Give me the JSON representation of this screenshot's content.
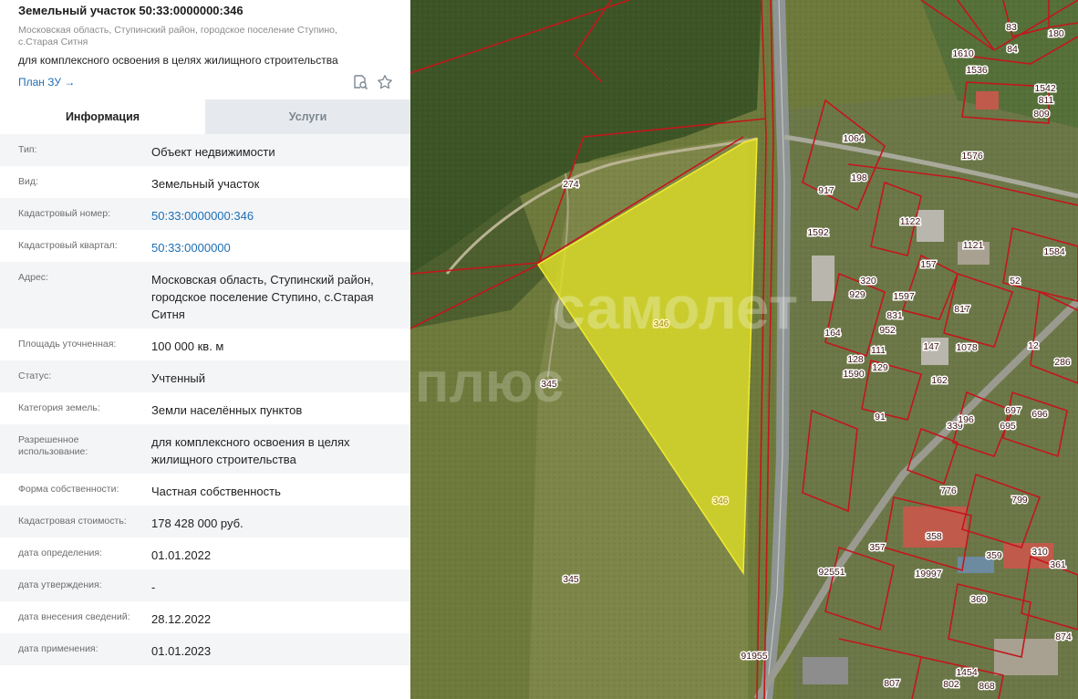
{
  "header": {
    "title": "Земельный участок 50:33:0000000:346",
    "address_line1": "Московская область, Ступинский район, городское поселение Ступино,",
    "address_line2": "с.Старая Ситня",
    "purpose": "для комплексного освоения в целях жилищного строительства",
    "plan_link": "План ЗУ →",
    "icons": {
      "doc": "document-search-icon",
      "star": "star-icon"
    }
  },
  "tabs": [
    {
      "label": "Информация",
      "active": true
    },
    {
      "label": "Услуги",
      "active": false
    }
  ],
  "rows": [
    {
      "label": "Тип:",
      "value": "Объект недвижимости"
    },
    {
      "label": "Вид:",
      "value": "Земельный участок"
    },
    {
      "label": "Кадастровый номер:",
      "value": "50:33:0000000:346",
      "link": true
    },
    {
      "label": "Кадастровый квартал:",
      "value": "50:33:0000000",
      "link": true
    },
    {
      "label": "Адрес:",
      "value": "Московская область, Ступинский район, городское поселение Ступино, с.Старая Ситня"
    },
    {
      "label": "Площадь уточненная:",
      "value": "100 000 кв. м"
    },
    {
      "label": "Статус:",
      "value": "Учтенный"
    },
    {
      "label": "Категория земель:",
      "value": "Земли населённых пунктов"
    },
    {
      "label": "Разрешенное использование:",
      "value": "для комплексного освоения в целях жилищного строительства"
    },
    {
      "label": "Форма собственности:",
      "value": "Частная собственность"
    },
    {
      "label": "Кадастровая стоимость:",
      "value": "178 428 000 руб."
    },
    {
      "label": "дата определения:",
      "value": "01.01.2022"
    },
    {
      "label": "дата утверждения:",
      "value": "-"
    },
    {
      "label": "дата внесения сведений:",
      "value": "28.12.2022"
    },
    {
      "label": "дата применения:",
      "value": "01.01.2023"
    }
  ],
  "map": {
    "watermark_line1": "самолет",
    "watermark_line2": "плюс",
    "parcel_labels": [
      "346",
      "346",
      "345",
      "345",
      "274",
      "1064",
      "1122",
      "1121",
      "1592",
      "1536",
      "1610",
      "1542",
      "180",
      "83",
      "84",
      "811",
      "809",
      "1576",
      "198",
      "917",
      "157",
      "320",
      "1597",
      "831",
      "929",
      "952",
      "164",
      "128",
      "111",
      "1590",
      "129",
      "147",
      "817",
      "1078",
      "162",
      "91",
      "339",
      "196",
      "697",
      "695",
      "696",
      "1584",
      "52",
      "12",
      "286",
      "776",
      "799",
      "358",
      "357",
      "359",
      "310",
      "361",
      "360",
      "874",
      "1454",
      "868",
      "807",
      "802",
      "91955",
      "92551",
      "19997"
    ],
    "colors": {
      "parcel_fill": "#e0e025",
      "boundary": "#c4161c",
      "road": "#9aa0a0",
      "field": "#6e7a3c",
      "forest": "#3d5526"
    }
  }
}
